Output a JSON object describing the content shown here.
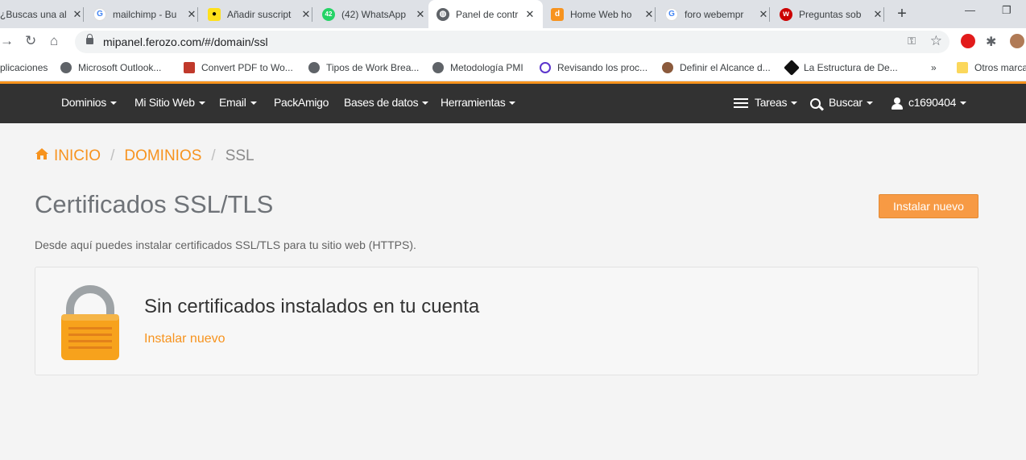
{
  "browser": {
    "tabs": [
      {
        "title": "¿Buscas una al",
        "favicon": "google-icon"
      },
      {
        "title": "mailchimp - Bu",
        "favicon": "google-icon"
      },
      {
        "title": "Añadir suscript",
        "favicon": "mailchimp-icon"
      },
      {
        "title": "(42) WhatsApp",
        "favicon": "whatsapp-icon"
      },
      {
        "title": "Panel de contr",
        "favicon": "globe-icon"
      },
      {
        "title": "Home Web ho",
        "favicon": "d-icon"
      },
      {
        "title": "foro webempr",
        "favicon": "google-icon"
      },
      {
        "title": "Preguntas sob",
        "favicon": "w-icon"
      }
    ],
    "active_tab_index": 4,
    "url": "mipanel.ferozo.com/#/domain/ssl",
    "bookmarks": [
      "plicaciones",
      "Microsoft Outlook...",
      "Convert PDF to Wo...",
      "Tipos de Work Brea...",
      "Metodología PMI",
      "Revisando los proc...",
      "Definir el Alcance d...",
      "La Estructura de De..."
    ],
    "bookmarks_more": "»",
    "other_bookmarks": "Otros marca"
  },
  "nav": {
    "items": [
      "Dominios",
      "Mi Sitio Web",
      "Email",
      "PackAmigo",
      "Bases de datos",
      "Herramientas"
    ],
    "tareas": "Tareas",
    "buscar": "Buscar",
    "user": "c1690404"
  },
  "breadcrumb": {
    "home": "INICIO",
    "dominios": "DOMINIOS",
    "current": "SSL"
  },
  "page": {
    "title": "Certificados SSL/TLS",
    "install_button": "Instalar nuevo",
    "description": "Desde aquí puedes instalar certificados SSL/TLS para tu sitio web (HTTPS).",
    "empty_title": "Sin certificados instalados en tu cuenta",
    "empty_link": "Instalar nuevo"
  },
  "colors": {
    "accent": "#f7931e",
    "navbar_bg": "#323232",
    "button_bg": "#f79a44"
  }
}
